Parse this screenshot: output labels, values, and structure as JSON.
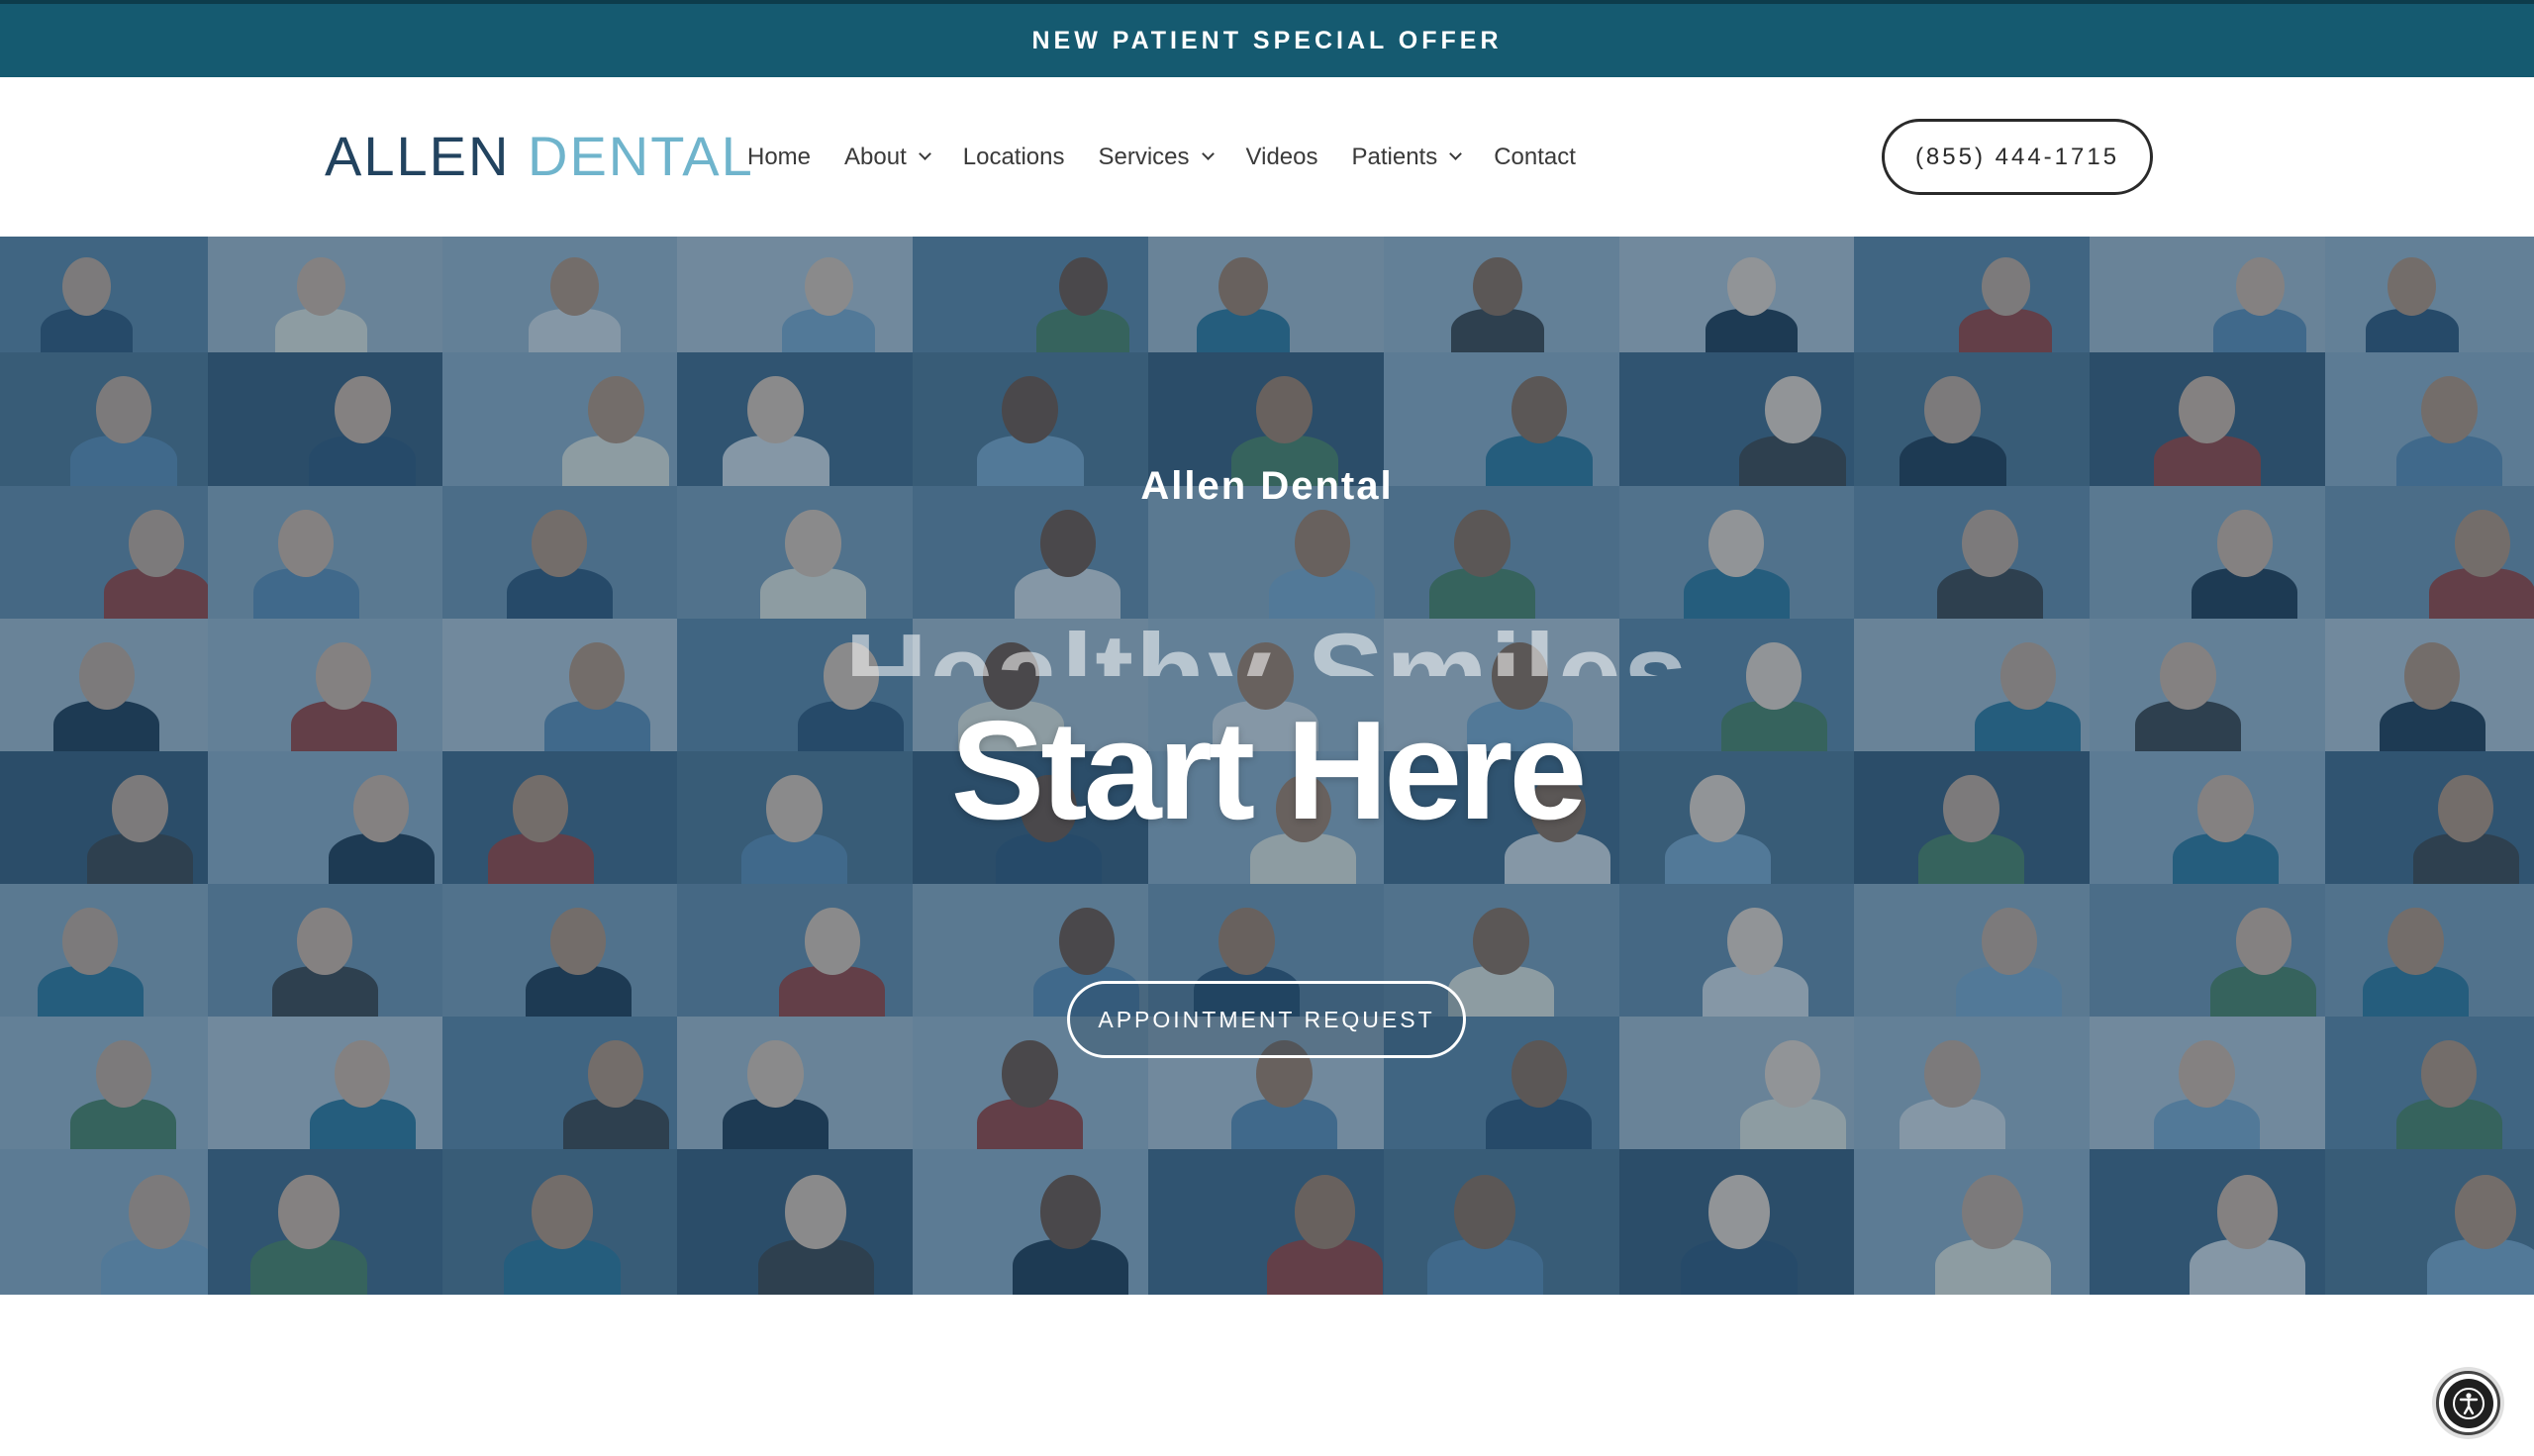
{
  "promo": {
    "label": "NEW PATIENT SPECIAL OFFER"
  },
  "header": {
    "logo_part1": "ALLEN",
    "logo_part2": "DENTAL",
    "phone": "(855) 444-1715",
    "nav": [
      {
        "label": "Home",
        "has_dropdown": false
      },
      {
        "label": "About",
        "has_dropdown": true
      },
      {
        "label": "Locations",
        "has_dropdown": false
      },
      {
        "label": "Services",
        "has_dropdown": true
      },
      {
        "label": "Videos",
        "has_dropdown": false
      },
      {
        "label": "Patients",
        "has_dropdown": true
      },
      {
        "label": "Contact",
        "has_dropdown": false
      }
    ]
  },
  "hero": {
    "kicker": "Allen Dental",
    "rotating_text": "Healthy Smiles",
    "title": "Start Here",
    "cta_label": "APPOINTMENT REQUEST"
  },
  "accessibility": {
    "icon": "accessibility-icon"
  },
  "colors": {
    "promo_bg": "#155a70",
    "logo_dark": "#22435f",
    "logo_light": "#6fb4cc",
    "hero_overlay": "#1e4869"
  }
}
